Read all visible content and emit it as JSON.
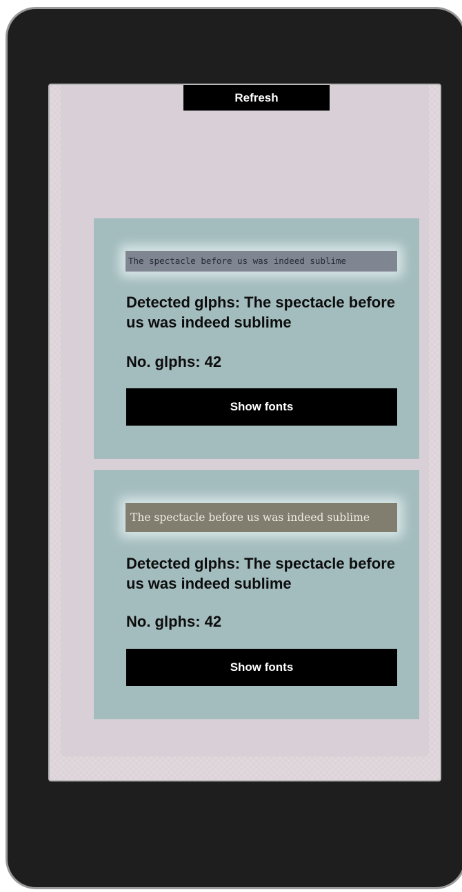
{
  "toolbar": {
    "refresh_label": "Refresh"
  },
  "results": [
    {
      "sample_text": "The spectacle before us was indeed sublime",
      "detected_label": "Detected glphs: The spectacle before us was indeed sublime",
      "count_label": "No. glphs: 42",
      "button_label": "Show fonts"
    },
    {
      "sample_text": "The spectacle before us was indeed sublime",
      "detected_label": "Detected glphs: The spectacle before us was indeed sublime",
      "count_label": "No. glphs: 42",
      "button_label": "Show fonts"
    }
  ],
  "colors": {
    "device_frame": "#1e1e1e",
    "screen_background": "#dcd2d8",
    "card_background": "#a3bcbe",
    "button_background": "#000000",
    "button_text": "#ffffff"
  }
}
